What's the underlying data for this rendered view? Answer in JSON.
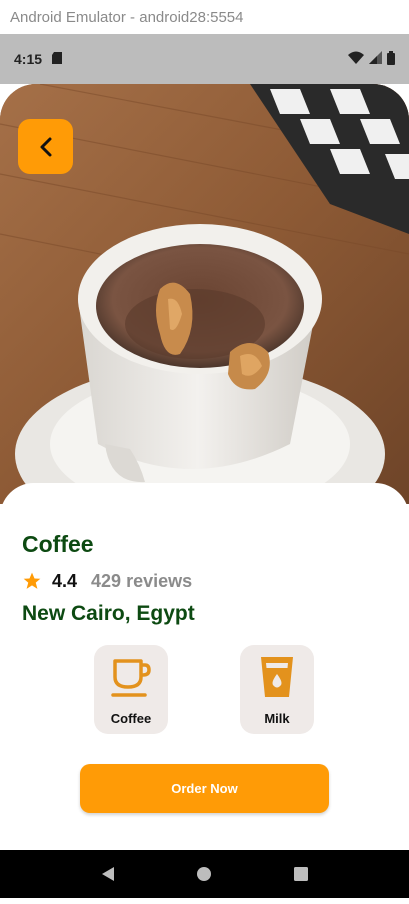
{
  "window": {
    "title": "Android Emulator - android28:5554"
  },
  "status_bar": {
    "time": "4:15",
    "icons": [
      "sd-card-icon",
      "wifi-icon",
      "signal-icon",
      "battery-icon"
    ]
  },
  "product": {
    "name": "Coffee",
    "rating": "4.4",
    "reviews": "429 reviews",
    "location": "New Cairo, Egypt",
    "options": [
      {
        "label": "Coffee",
        "icon": "coffee-cup-icon"
      },
      {
        "label": "Milk",
        "icon": "milk-glass-icon"
      }
    ],
    "order_label": "Order Now"
  },
  "colors": {
    "accent": "#ff9b06",
    "title_green": "#0d4a12",
    "option_bg": "#efeae8"
  }
}
